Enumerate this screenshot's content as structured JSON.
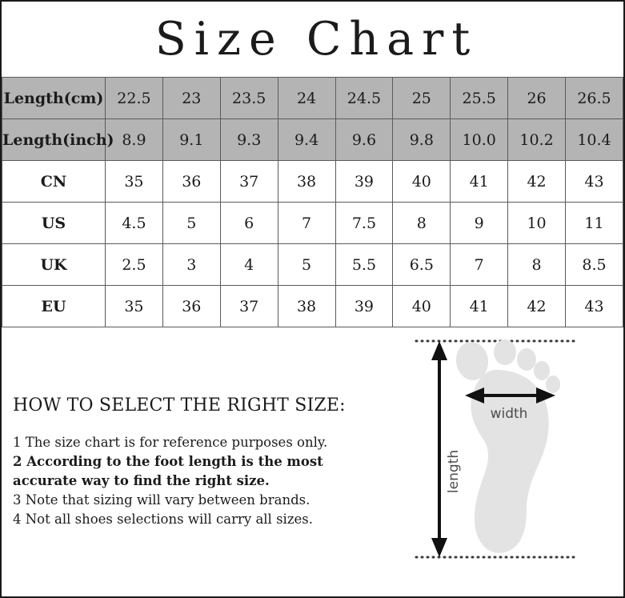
{
  "title": "Size Chart",
  "table": {
    "rows": [
      {
        "label": "Length(cm)",
        "header": true,
        "values": [
          "22.5",
          "23",
          "23.5",
          "24",
          "24.5",
          "25",
          "25.5",
          "26",
          "26.5"
        ]
      },
      {
        "label": "Length(inch)",
        "header": true,
        "values": [
          "8.9",
          "9.1",
          "9.3",
          "9.4",
          "9.6",
          "9.8",
          "10.0",
          "10.2",
          "10.4"
        ]
      },
      {
        "label": "CN",
        "header": false,
        "values": [
          "35",
          "36",
          "37",
          "38",
          "39",
          "40",
          "41",
          "42",
          "43"
        ]
      },
      {
        "label": "US",
        "header": false,
        "values": [
          "4.5",
          "5",
          "6",
          "7",
          "7.5",
          "8",
          "9",
          "10",
          "11"
        ]
      },
      {
        "label": "UK",
        "header": false,
        "values": [
          "2.5",
          "3",
          "4",
          "5",
          "5.5",
          "6.5",
          "7",
          "8",
          "8.5"
        ]
      },
      {
        "label": "EU",
        "header": false,
        "values": [
          "35",
          "36",
          "37",
          "38",
          "39",
          "40",
          "41",
          "42",
          "43"
        ]
      }
    ]
  },
  "howto": {
    "heading": "HOW TO SELECT THE RIGHT SIZE:",
    "items": [
      {
        "text": "1 The size chart is for reference purposes only.",
        "bold": false
      },
      {
        "text": "2 According to the foot length is the most accurate way to find the right size.",
        "bold": true
      },
      {
        "text": "3 Note that sizing will vary between brands.",
        "bold": false
      },
      {
        "text": "4 Not all shoes selections will carry all sizes.",
        "bold": false
      }
    ]
  },
  "diagram": {
    "width_label": "width",
    "length_label": "length",
    "foot_color": "#e3e3e3",
    "arrow_color": "#111111",
    "label_color": "#4d4d4d",
    "guide_color": "#3a3a3a"
  },
  "colors": {
    "header_gray": "#b4b4b4",
    "border": "#5a5a5a",
    "outer_border": "#1a1a1a",
    "text": "#1b1b1b",
    "background": "#ffffff"
  }
}
